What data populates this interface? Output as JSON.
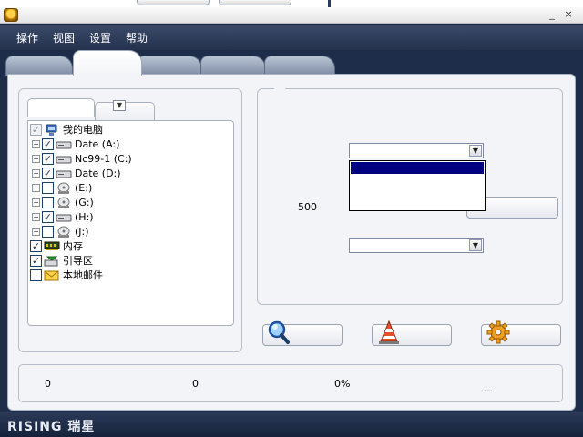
{
  "menu": {
    "items": [
      "操作",
      "视图",
      "设置",
      "帮助"
    ]
  },
  "window_buttons": {
    "minimize": "_",
    "close": "×"
  },
  "tree": {
    "root": "我的电脑",
    "drives": [
      {
        "label": "Date (A:)",
        "checked": true,
        "icon": "drive-icon"
      },
      {
        "label": "Nc99-1 (C:)",
        "checked": true,
        "icon": "drive-icon"
      },
      {
        "label": "Date (D:)",
        "checked": true,
        "icon": "drive-icon"
      },
      {
        "label": "(E:)",
        "checked": false,
        "icon": "cd-drive-icon"
      },
      {
        "label": "(G:)",
        "checked": false,
        "icon": "cd-drive-icon"
      },
      {
        "label": "(H:)",
        "checked": true,
        "icon": "drive-icon"
      },
      {
        "label": "(J:)",
        "checked": false,
        "icon": "cd-drive-icon"
      }
    ],
    "extras": [
      {
        "label": "内存",
        "checked": true,
        "icon": "memory-icon"
      },
      {
        "label": "引导区",
        "checked": true,
        "icon": "boot-sector-icon"
      },
      {
        "label": "本地邮件",
        "checked": false,
        "icon": "mail-icon"
      }
    ]
  },
  "settings_panel": {
    "value_500": "500"
  },
  "status": {
    "count1": "0",
    "count2": "0",
    "percent": "0%",
    "dash": "__"
  },
  "footer": {
    "logo": "RISING 瑞星"
  },
  "colors": {
    "frame": "#1e2e4a",
    "panel": "#f3f4f7",
    "selection": "#000080"
  }
}
